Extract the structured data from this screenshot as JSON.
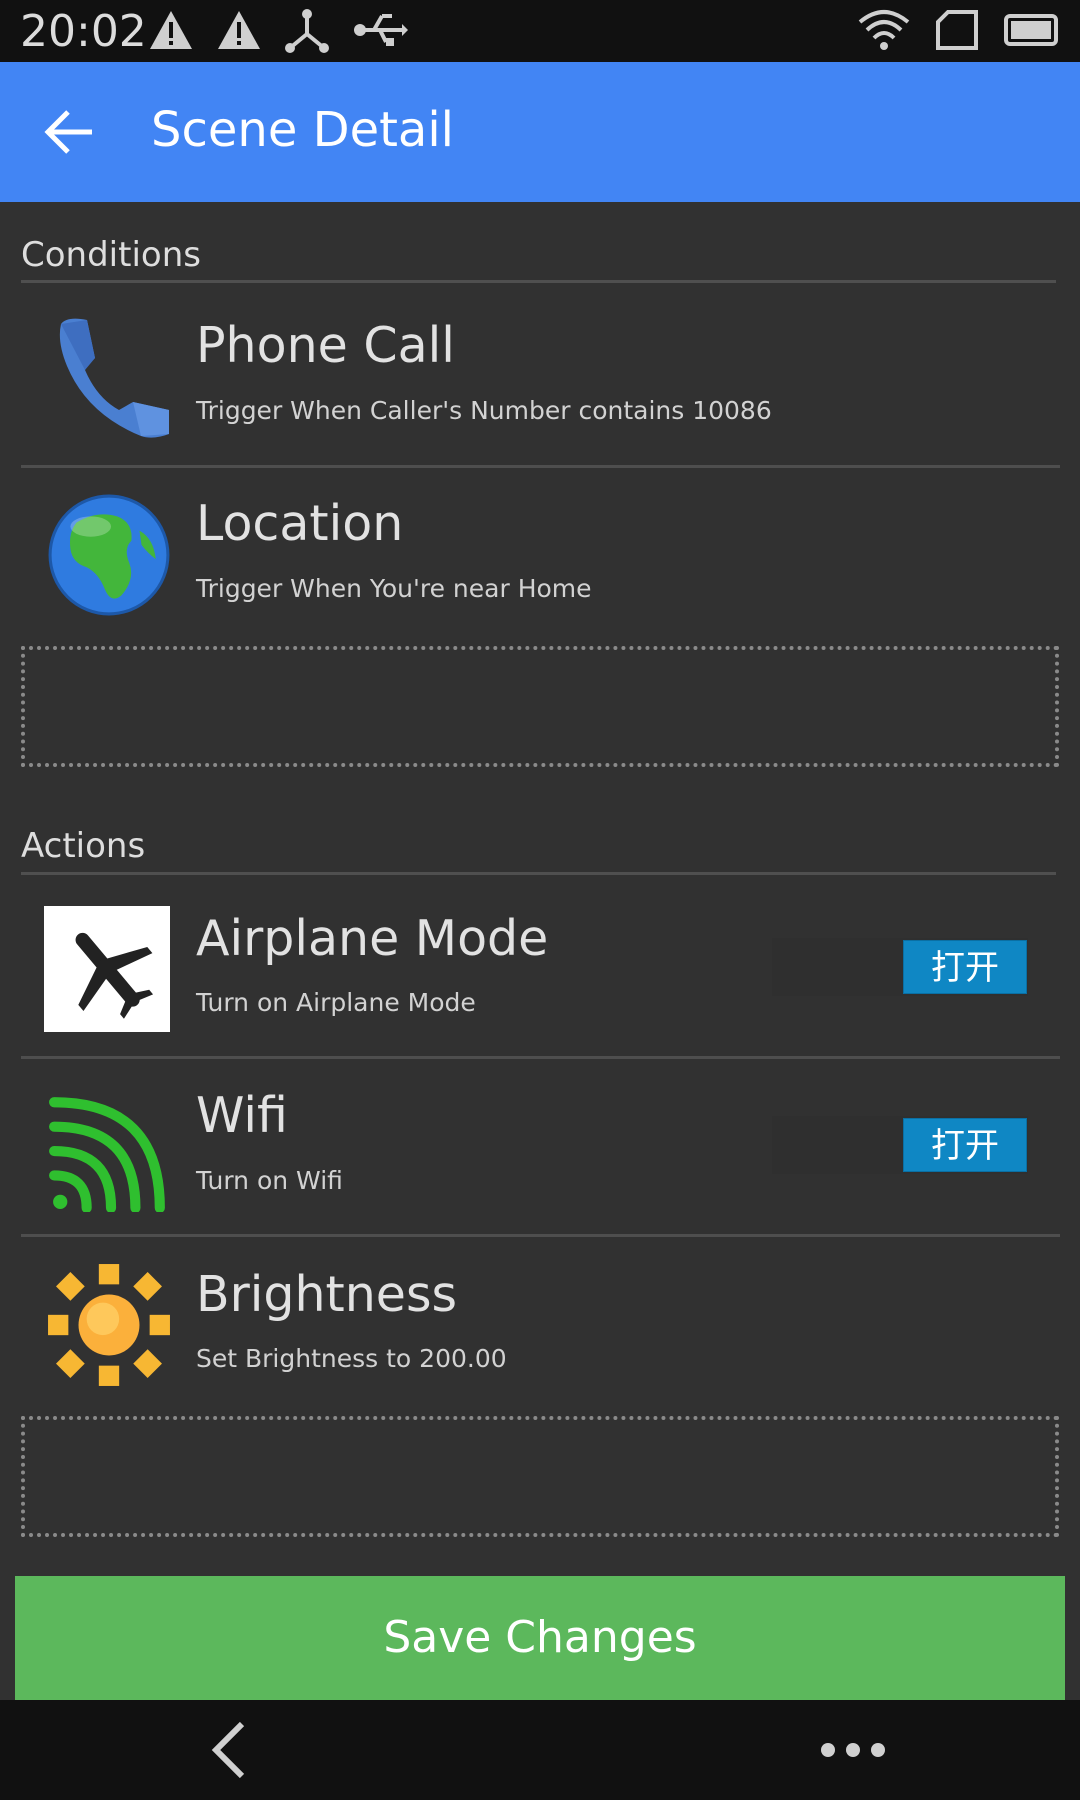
{
  "status_bar": {
    "time": "20:02",
    "icons": [
      "warning-icon",
      "warning-icon",
      "usb-debug-icon",
      "usb-icon",
      "wifi-icon",
      "sim-icon",
      "battery-icon"
    ]
  },
  "app_bar": {
    "title": "Scene Detail",
    "back_icon": "arrow-left-icon"
  },
  "conditions": {
    "label": "Conditions",
    "items": [
      {
        "title": "Phone Call",
        "subtitle": "Trigger When Caller's Number contains 10086",
        "icon": "phone-icon"
      },
      {
        "title": "Location",
        "subtitle": "Trigger When You're near Home",
        "icon": "globe-icon"
      }
    ]
  },
  "actions": {
    "label": "Actions",
    "items": [
      {
        "title": "Airplane Mode",
        "subtitle": "Turn on Airplane Mode",
        "icon": "airplane-icon",
        "toggle": "打开"
      },
      {
        "title": "Wifi",
        "subtitle": "Turn on Wifi",
        "icon": "wifi-signal-icon",
        "toggle": "打开"
      },
      {
        "title": "Brightness",
        "subtitle": "Set Brightness to 200.00",
        "icon": "sun-icon"
      }
    ]
  },
  "save_button": {
    "label": "Save Changes"
  },
  "nav_bar": {
    "icons": [
      "nav-back-icon",
      "nav-more-icon"
    ]
  },
  "colors": {
    "app_bar": "#4285f4",
    "background": "#313131",
    "save_button": "#5cb85c",
    "toggle": "#0f87c4"
  }
}
